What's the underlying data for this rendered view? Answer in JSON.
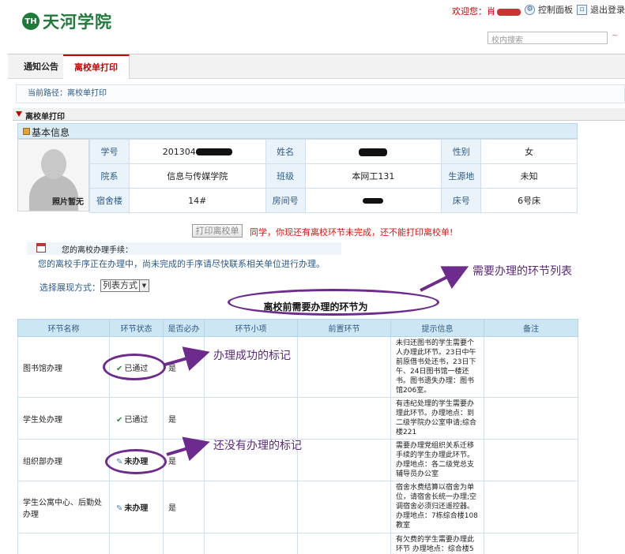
{
  "header": {
    "logo_mark": "TH",
    "logo_text": "天河学院",
    "welcome_label": "欢迎您：",
    "welcome_name_visible": "肖",
    "control_panel": "控制面板",
    "logout": "退出登录",
    "search_placeholder": "校内搜索",
    "search_go": "~"
  },
  "nav": {
    "tabs": [
      {
        "label": "通知公告"
      },
      {
        "label": "离校单打印"
      }
    ]
  },
  "breadcrumb": "当前路径：离校单打印",
  "section_title": "离校单打印",
  "basic_info": {
    "title": "基本信息",
    "photo_caption": "照片暂无",
    "rows": [
      {
        "l1": "学号",
        "v1": "201304",
        "l2": "姓名",
        "v2": "",
        "l3": "性别",
        "v3": "女"
      },
      {
        "l1": "院系",
        "v1": "信息与传媒学院",
        "l2": "班级",
        "v2": "本网工131",
        "l3": "生源地",
        "v3": "未知"
      },
      {
        "l1": "宿舍楼",
        "v1": "14#",
        "l2": "房间号",
        "v2": "",
        "l3": "床号",
        "v3": "6号床"
      }
    ]
  },
  "print": {
    "button": "打印离校单",
    "message": "同学，你现还有离校环节未完成，还不能打印离校单!"
  },
  "procedure": {
    "title": "您的离校办理手续：",
    "note": "您的离校手序正在办理中，尚未完成的手序请尽快联系相关单位进行办理。"
  },
  "view": {
    "label": "选择展现方式：",
    "selected": "列表方式"
  },
  "env_title": "离校前需要办理的环节为",
  "annotations": {
    "list": "需要办理的环节列表",
    "success": "办理成功的标记",
    "pending": "还没有办理的标记"
  },
  "env_table": {
    "headers": [
      "环节名称",
      "环节状态",
      "是否必办",
      "环节小项",
      "前置环节",
      "提示信息",
      "备注"
    ],
    "rows": [
      {
        "name": "图书馆办理",
        "status": "已通过",
        "required": "是",
        "tip": "未归还图书的学生需要个人办理此环节。23日中午前原借书处还书，23日下午、24日图书馆一楼还书。图书遗失办理：图书馆206室。"
      },
      {
        "name": "学生处办理",
        "status": "已通过",
        "required": "是",
        "tip": "有违纪处理的学生需要办理此环节。办理地点：到二级学院办公室申请;综合楼221"
      },
      {
        "name": "组织部办理",
        "status": "未办理",
        "required": "是",
        "tip": "需要办理党组织关系迁移手续的学生办理此环节。办理地点：各二级党总支辅导员办公室"
      },
      {
        "name": "学生公寓中心、后勤处办理",
        "status": "未办理",
        "required": "是",
        "tip": "宿舍水费结算以宿舍为单位，请宿舍长统一办理;空调宿舍必须归还遥控器。办理地点：7栋综合楼108教室"
      },
      {
        "name": "",
        "status": "",
        "required": "",
        "tip": "有欠费的学生需要办理此环节 办理地点：综合楼5"
      }
    ]
  },
  "colors": {
    "accent_red": "#cc0000",
    "annotation_purple": "#6d2b8e",
    "header_blue": "#cde6f3"
  }
}
